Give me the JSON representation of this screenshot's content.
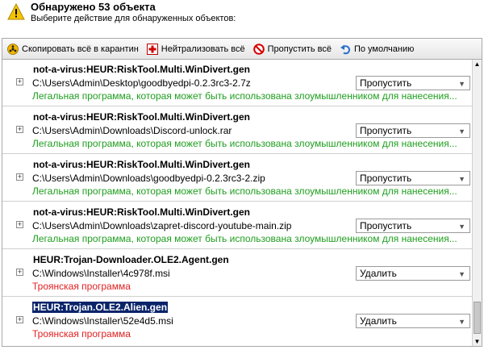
{
  "header": {
    "title": "Обнаружено 53 объекта",
    "subtitle": "Выберите действие для обнаруженных объектов:",
    "icon": "warning-icon"
  },
  "toolbar": {
    "quarantine_all": "Скопировать всё в карантин",
    "neutralize_all": "Нейтрализовать всё",
    "skip_all": "Пропустить всё",
    "default": "По умолчанию"
  },
  "items": [
    {
      "name": "not-a-virus:HEUR:RiskTool.Multi.WinDivert.gen",
      "path": "C:\\Users\\Admin\\Desktop\\goodbyedpi-0.2.3rc3-2.7z",
      "description": "Легальная программа, которая может быть использована злоумышленником для нанесения...",
      "action": "Пропустить",
      "severity": "green"
    },
    {
      "name": "not-a-virus:HEUR:RiskTool.Multi.WinDivert.gen",
      "path": "C:\\Users\\Admin\\Downloads\\Discord-unlock.rar",
      "description": "Легальная программа, которая может быть использована злоумышленником для нанесения...",
      "action": "Пропустить",
      "severity": "green"
    },
    {
      "name": "not-a-virus:HEUR:RiskTool.Multi.WinDivert.gen",
      "path": "C:\\Users\\Admin\\Downloads\\goodbyedpi-0.2.3rc3-2.zip",
      "description": "Легальная программа, которая может быть использована злоумышленником для нанесения...",
      "action": "Пропустить",
      "severity": "green"
    },
    {
      "name": "not-a-virus:HEUR:RiskTool.Multi.WinDivert.gen",
      "path": "C:\\Users\\Admin\\Downloads\\zapret-discord-youtube-main.zip",
      "description": "Легальная программа, которая может быть использована злоумышленником для нанесения...",
      "action": "Пропустить",
      "severity": "green"
    },
    {
      "name": "HEUR:Trojan-Downloader.OLE2.Agent.gen",
      "path": "C:\\Windows\\Installer\\4c978f.msi",
      "description": "Троянская программа",
      "action": "Удалить",
      "severity": "red"
    },
    {
      "name": "HEUR:Trojan.OLE2.Alien.gen",
      "path": "C:\\Windows\\Installer\\52e4d5.msi",
      "description": "Троянская программа",
      "action": "Удалить",
      "severity": "red",
      "selected": true
    }
  ],
  "colors": {
    "legal": "#1e9e1e",
    "trojan": "#e02020",
    "selection": "#0a246a"
  }
}
